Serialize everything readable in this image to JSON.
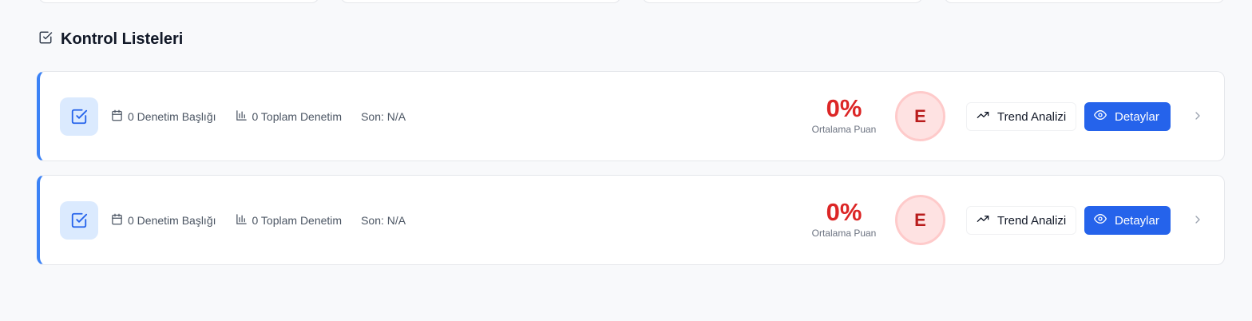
{
  "section": {
    "title": "Kontrol Listeleri",
    "icon": "checkbox-icon"
  },
  "checklists": [
    {
      "icon": "checkbox-icon",
      "audit_titles": "0 Denetim Başlığı",
      "total_audits": "0 Toplam Denetim",
      "last": "Son: N/A",
      "score": "0%",
      "score_label": "Ortalama Puan",
      "grade": "E",
      "trend_label": "Trend Analizi",
      "detail_label": "Detaylar"
    },
    {
      "icon": "checkbox-icon",
      "audit_titles": "0 Denetim Başlığı",
      "total_audits": "0 Toplam Denetim",
      "last": "Son: N/A",
      "score": "0%",
      "score_label": "Ortalama Puan",
      "grade": "E",
      "trend_label": "Trend Analizi",
      "detail_label": "Detaylar"
    }
  ],
  "colors": {
    "accent": "#2563eb",
    "card_border_left": "#3b82f6",
    "score": "#dc2626",
    "grade_bg": "#fee2e2",
    "grade_text": "#b91c1c"
  }
}
